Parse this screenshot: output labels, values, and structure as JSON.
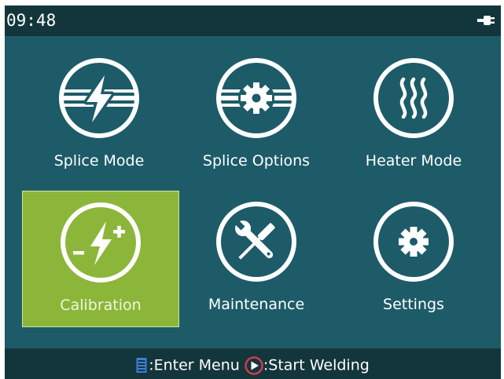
{
  "status": {
    "time": "09:48",
    "power_icon": "power-plug-icon"
  },
  "menu": {
    "items": [
      {
        "label": "Splice Mode",
        "icon": "splice-mode-icon",
        "selected": false
      },
      {
        "label": "Splice Options",
        "icon": "splice-options-icon",
        "selected": false
      },
      {
        "label": "Heater Mode",
        "icon": "heater-mode-icon",
        "selected": false
      },
      {
        "label": "Calibration",
        "icon": "calibration-icon",
        "selected": true
      },
      {
        "label": "Maintenance",
        "icon": "maintenance-icon",
        "selected": false
      },
      {
        "label": "Settings",
        "icon": "settings-icon",
        "selected": false
      }
    ]
  },
  "footer": {
    "enter_sep": ":",
    "enter_label": "Enter Menu",
    "start_sep": ":",
    "start_label": "Start Welding",
    "menu_key_icon": "menu-key-icon",
    "start_key_icon": "start-key-icon"
  },
  "colors": {
    "background": "#1d5b69",
    "bars": "#13363c",
    "selected": "#8cb63a",
    "text": "#ffffff",
    "menu_key": "#3e7fd6",
    "start_key": "#cf3b4f"
  }
}
